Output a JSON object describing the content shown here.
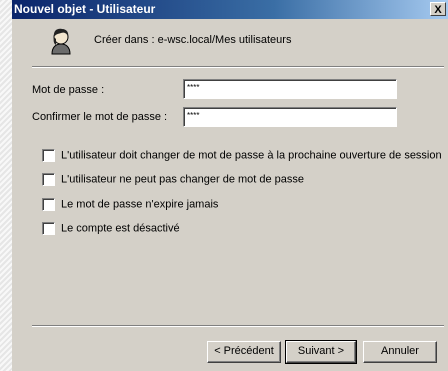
{
  "window": {
    "title": "Nouvel objet - Utilisateur",
    "close_label": "X"
  },
  "header": {
    "create_in": "Créer dans :  e-wsc.local/Mes utilisateurs",
    "icon": "user-icon"
  },
  "form": {
    "password_label": "Mot de passe :",
    "password_value": "****",
    "confirm_label": "Confirmer le mot de passe :",
    "confirm_value": "****"
  },
  "options": [
    {
      "label": "L'utilisateur doit changer de mot de passe à la prochaine ouverture de session",
      "checked": false
    },
    {
      "label": "L'utilisateur ne peut pas changer de mot de passe",
      "checked": false
    },
    {
      "label": "Le mot de passe n'expire jamais",
      "checked": false
    },
    {
      "label": "Le compte est désactivé",
      "checked": false
    }
  ],
  "buttons": {
    "back": "< Précédent",
    "next": "Suivant >",
    "cancel": "Annuler"
  }
}
